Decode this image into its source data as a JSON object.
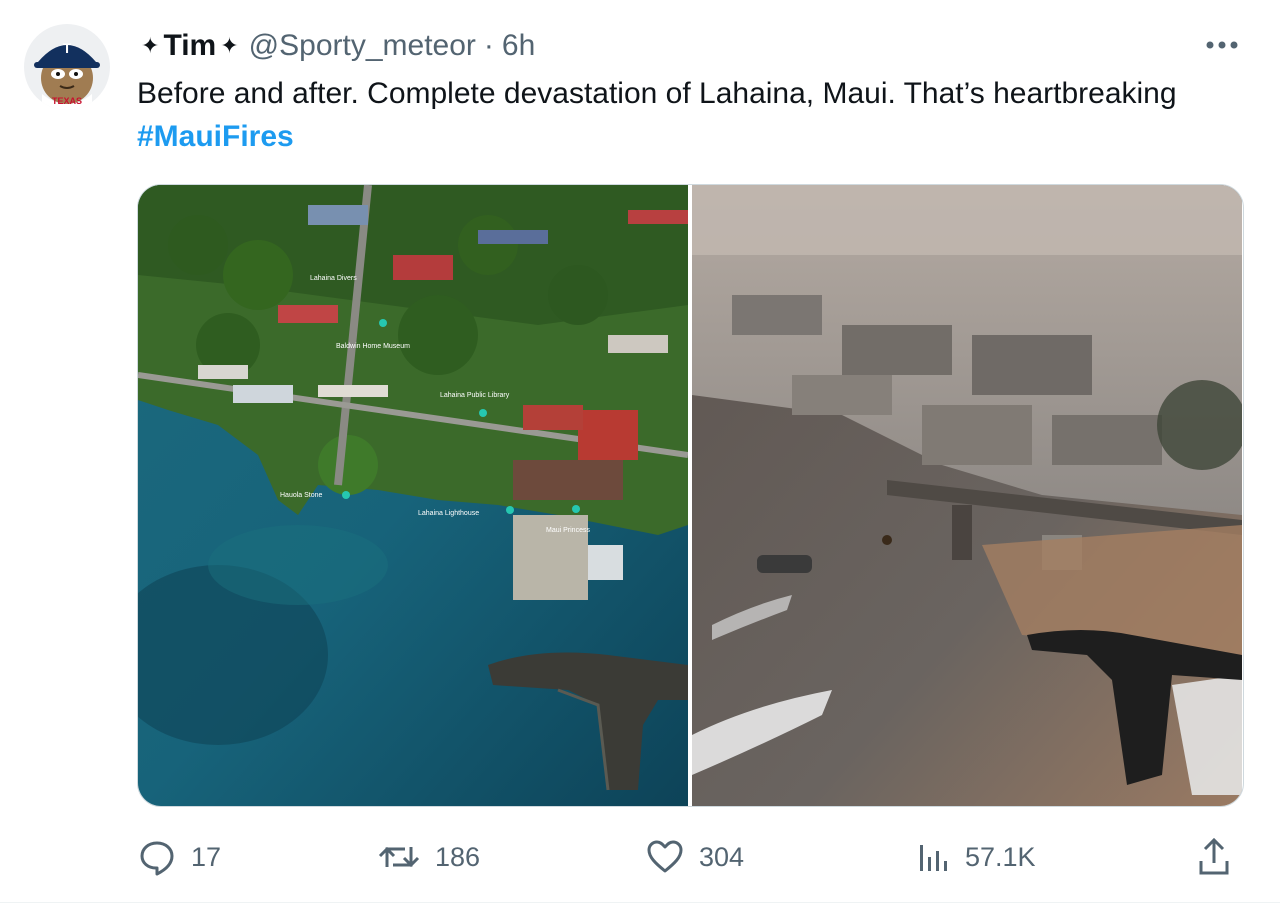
{
  "tweet": {
    "display_name": "Tim",
    "name_decoration": "✦",
    "handle": "@Sporty_meteor",
    "separator": "·",
    "time": "6h",
    "text": "Before and after. Complete devastation of Lahaina, Maui. That’s heartbreaking ",
    "hashtag": "#MauiFires"
  },
  "avatar": {
    "cap_letter": "T",
    "badge_text": "TEXAS"
  },
  "media": {
    "before_labels": {
      "lahaina_divers": "Lahaina Divers",
      "baldwin": "Baldwin Home Museum",
      "library": "Lahaina Public Library",
      "hauola": "Hauola Stone",
      "lighthouse": "Lahaina Lighthouse",
      "maui_princess": "Maui Princess"
    }
  },
  "actions": {
    "replies": "17",
    "retweets": "186",
    "likes": "304",
    "views": "57.1K"
  },
  "colors": {
    "accent": "#1d9bf0",
    "muted": "#536471",
    "text": "#0f1419"
  },
  "icons": [
    "more-icon",
    "reply-icon",
    "retweet-icon",
    "like-icon",
    "views-icon",
    "share-icon"
  ]
}
